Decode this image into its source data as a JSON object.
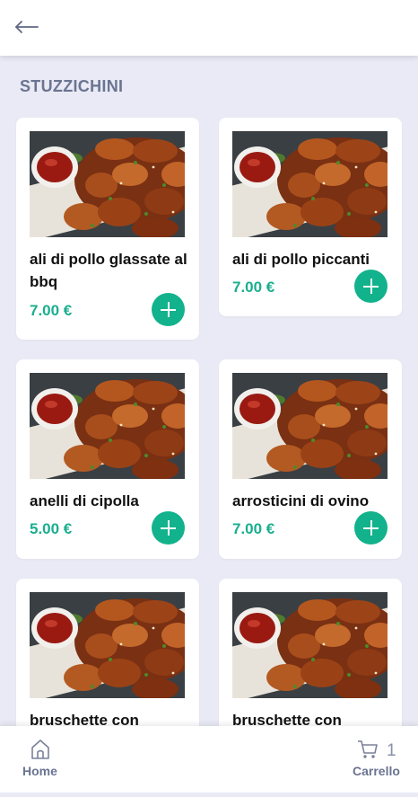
{
  "header": {
    "back_icon": "arrow-left-icon"
  },
  "section": {
    "title": "STUZZICHINI"
  },
  "products": [
    {
      "name": "ali di pollo glassate al bbq",
      "price": "7.00 €"
    },
    {
      "name": "ali di pollo piccanti",
      "price": "7.00 €"
    },
    {
      "name": "anelli di cipolla",
      "price": "5.00 €"
    },
    {
      "name": "arrosticini di ovino",
      "price": "7.00 €"
    },
    {
      "name": "bruschette con",
      "price": ""
    },
    {
      "name": "bruschette con",
      "price": ""
    }
  ],
  "bottom_nav": {
    "home_label": "Home",
    "cart_label": "Carrello",
    "cart_count": "1"
  },
  "colors": {
    "accent": "#12b28c",
    "price": "#1aae8e",
    "background": "#e9eaf5",
    "muted_text": "#6b7491"
  }
}
